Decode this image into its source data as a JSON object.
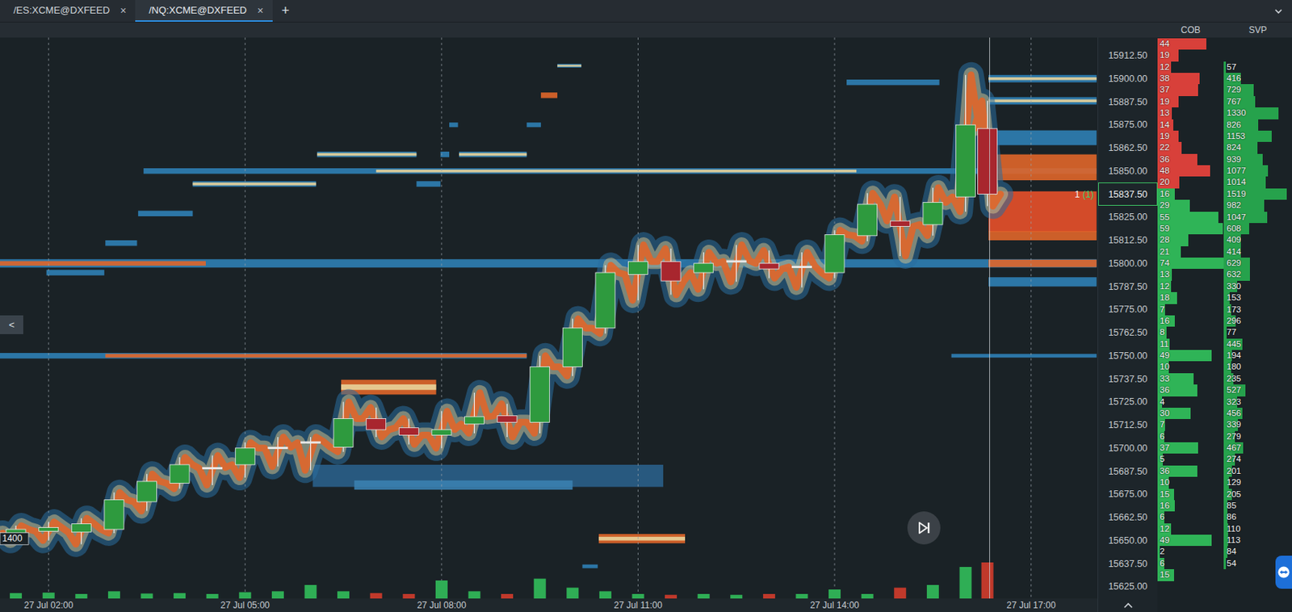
{
  "tabs": [
    {
      "label": "/ES:XCME@DXFEED",
      "close": "×",
      "selected": false
    },
    {
      "label": "/NQ:XCME@DXFEED",
      "close": "×",
      "selected": true
    }
  ],
  "new_tab": "+",
  "columns": {
    "cob": "COB",
    "svp": "SVP"
  },
  "collapse_button": "<",
  "left_label": {
    "text": "1400",
    "price": 15651
  },
  "marker": {
    "count": "1",
    "detail": "(1)",
    "price": 15837.5
  },
  "now": 982,
  "price_axis": {
    "labels": [
      {
        "text": "15912.50",
        "selected": false
      },
      {
        "text": "15900.00",
        "selected": false
      },
      {
        "text": "15887.50",
        "selected": false
      },
      {
        "text": "15875.00",
        "selected": false
      },
      {
        "text": "15862.50",
        "selected": false
      },
      {
        "text": "15850.00",
        "selected": false
      },
      {
        "text": "15837.50",
        "selected": true
      },
      {
        "text": "15825.00",
        "selected": false
      },
      {
        "text": "15812.50",
        "selected": false
      },
      {
        "text": "15800.00",
        "selected": false
      },
      {
        "text": "15787.50",
        "selected": false
      },
      {
        "text": "15775.00",
        "selected": false
      },
      {
        "text": "15762.50",
        "selected": false
      },
      {
        "text": "15750.00",
        "selected": false
      },
      {
        "text": "15737.50",
        "selected": false
      },
      {
        "text": "15725.00",
        "selected": false
      },
      {
        "text": "15712.50",
        "selected": false
      },
      {
        "text": "15700.00",
        "selected": false
      },
      {
        "text": "15687.50",
        "selected": false
      },
      {
        "text": "15675.00",
        "selected": false
      },
      {
        "text": "15662.50",
        "selected": false
      },
      {
        "text": "15650.00",
        "selected": false
      },
      {
        "text": "15637.50",
        "selected": false
      },
      {
        "text": "15625.00",
        "selected": false
      }
    ]
  },
  "time_axis": {
    "labels": [
      {
        "text": "27 Jul 02:00",
        "t": 120
      },
      {
        "text": "27 Jul 05:00",
        "t": 300
      },
      {
        "text": "27 Jul 08:00",
        "t": 480
      },
      {
        "text": "27 Jul 11:00",
        "t": 660
      },
      {
        "text": "27 Jul 14:00",
        "t": 840
      },
      {
        "text": "27 Jul 17:00",
        "t": 1020
      }
    ]
  },
  "cob": [
    {
      "value": "44",
      "side": "ask"
    },
    {
      "value": "19",
      "side": "ask"
    },
    {
      "value": "12",
      "side": "ask"
    },
    {
      "value": "38",
      "side": "ask"
    },
    {
      "value": "37",
      "side": "ask"
    },
    {
      "value": "19",
      "side": "ask"
    },
    {
      "value": "13",
      "side": "ask"
    },
    {
      "value": "14",
      "side": "ask"
    },
    {
      "value": "19",
      "side": "ask"
    },
    {
      "value": "22",
      "side": "ask"
    },
    {
      "value": "36",
      "side": "ask"
    },
    {
      "value": "48",
      "side": "ask"
    },
    {
      "value": "20",
      "side": "ask"
    },
    {
      "value": "16",
      "side": "bid"
    },
    {
      "value": "29",
      "side": "bid"
    },
    {
      "value": "55",
      "side": "bid"
    },
    {
      "value": "59",
      "side": "bid"
    },
    {
      "value": "28",
      "side": "bid"
    },
    {
      "value": "21",
      "side": "bid"
    },
    {
      "value": "74",
      "side": "bid"
    },
    {
      "value": "13",
      "side": "bid"
    },
    {
      "value": "12",
      "side": "bid"
    },
    {
      "value": "18",
      "side": "bid"
    },
    {
      "value": "7",
      "side": "bid"
    },
    {
      "value": "16",
      "side": "bid"
    },
    {
      "value": "8",
      "side": "bid"
    },
    {
      "value": "11",
      "side": "bid"
    },
    {
      "value": "49",
      "side": "bid"
    },
    {
      "value": "10",
      "side": "bid"
    },
    {
      "value": "33",
      "side": "bid"
    },
    {
      "value": "36",
      "side": "bid"
    },
    {
      "value": "4",
      "side": "bid"
    },
    {
      "value": "30",
      "side": "bid"
    },
    {
      "value": "7",
      "side": "bid"
    },
    {
      "value": "6",
      "side": "bid"
    },
    {
      "value": "37",
      "side": "bid"
    },
    {
      "value": "5",
      "side": "bid"
    },
    {
      "value": "36",
      "side": "bid"
    },
    {
      "value": "10",
      "side": "bid"
    },
    {
      "value": "15",
      "side": "bid"
    },
    {
      "value": "16",
      "side": "bid"
    },
    {
      "value": "6",
      "side": "bid"
    },
    {
      "value": "12",
      "side": "bid"
    },
    {
      "value": "49",
      "side": "bid"
    },
    {
      "value": "2",
      "side": "bid"
    },
    {
      "value": "6",
      "side": "bid"
    },
    {
      "value": "15",
      "side": "bid"
    }
  ],
  "svp": [
    "57",
    "416",
    "729",
    "767",
    "1330",
    "826",
    "1153",
    "824",
    "939",
    "1077",
    "1014",
    "1519",
    "982",
    "1047",
    "608",
    "409",
    "414",
    "629",
    "632",
    "330",
    "153",
    "173",
    "296",
    "77",
    "445",
    "194",
    "180",
    "235",
    "527",
    "323",
    "456",
    "339",
    "279",
    "467",
    "274",
    "201",
    "129",
    "205",
    "85",
    "86",
    "110",
    "113",
    "84",
    "54"
  ],
  "candles": [
    {
      "t": 90,
      "open": 15654,
      "high": 15658,
      "low": 15650,
      "close": 15656,
      "volume": 600
    },
    {
      "t": 120,
      "open": 15655,
      "high": 15660,
      "low": 15650,
      "close": 15657,
      "volume": 650
    },
    {
      "t": 150,
      "open": 15654.5,
      "high": 15662,
      "low": 15648,
      "close": 15659,
      "volume": 500
    },
    {
      "t": 180,
      "open": 15656,
      "high": 15676,
      "low": 15654,
      "close": 15672,
      "volume": 800
    },
    {
      "t": 210,
      "open": 15671,
      "high": 15686,
      "low": 15666,
      "close": 15682,
      "volume": 550
    },
    {
      "t": 240,
      "open": 15681,
      "high": 15695,
      "low": 15678,
      "close": 15691,
      "volume": 600
    },
    {
      "t": 270,
      "open": 15689,
      "high": 15696,
      "low": 15680,
      "close": 15689.5,
      "volume": 500
    },
    {
      "t": 300,
      "open": 15691,
      "high": 15703,
      "low": 15684,
      "close": 15700,
      "volume": 700
    },
    {
      "t": 330,
      "open": 15700,
      "high": 15706,
      "low": 15690,
      "close": 15700.5,
      "volume": 800
    },
    {
      "t": 360,
      "open": 15703,
      "high": 15706,
      "low": 15688,
      "close": 15703.5,
      "volume": 1500
    },
    {
      "t": 390,
      "open": 15700.5,
      "high": 15725,
      "low": 15698,
      "close": 15716,
      "volume": 800
    },
    {
      "t": 420,
      "open": 15716,
      "high": 15722,
      "low": 15706,
      "close": 15710,
      "volume": 600
    },
    {
      "t": 450,
      "open": 15711,
      "high": 15716,
      "low": 15702,
      "close": 15707,
      "volume": 500
    },
    {
      "t": 480,
      "open": 15707,
      "high": 15720,
      "low": 15700,
      "close": 15710,
      "volume": 2000
    },
    {
      "t": 510,
      "open": 15713,
      "high": 15730,
      "low": 15708,
      "close": 15717,
      "volume": 800
    },
    {
      "t": 540,
      "open": 15717.5,
      "high": 15724,
      "low": 15706,
      "close": 15714,
      "volume": 500
    },
    {
      "t": 570,
      "open": 15714,
      "high": 15750,
      "low": 15708,
      "close": 15744,
      "volume": 2200
    },
    {
      "t": 600,
      "open": 15744,
      "high": 15770,
      "low": 15739,
      "close": 15765,
      "volume": 1200
    },
    {
      "t": 630,
      "open": 15765,
      "high": 15799,
      "low": 15762,
      "close": 15795,
      "volume": 800
    },
    {
      "t": 660,
      "open": 15794,
      "high": 15810,
      "low": 15780,
      "close": 15801,
      "volume": 500
    },
    {
      "t": 690,
      "open": 15801,
      "high": 15808,
      "low": 15783,
      "close": 15790.5,
      "volume": 400
    },
    {
      "t": 720,
      "open": 15795,
      "high": 15806,
      "low": 15786,
      "close": 15800,
      "volume": 500
    },
    {
      "t": 750,
      "open": 15801,
      "high": 15810,
      "low": 15790,
      "close": 15801.5,
      "volume": 400
    },
    {
      "t": 780,
      "open": 15800,
      "high": 15807,
      "low": 15792,
      "close": 15797,
      "volume": 500
    },
    {
      "t": 810,
      "open": 15798,
      "high": 15806,
      "low": 15787,
      "close": 15798.5,
      "volume": 500
    },
    {
      "t": 840,
      "open": 15795,
      "high": 15818,
      "low": 15792,
      "close": 15815.5,
      "volume": 1000
    },
    {
      "t": 870,
      "open": 15815,
      "high": 15838,
      "low": 15812,
      "close": 15832,
      "volume": 500
    },
    {
      "t": 900,
      "open": 15823,
      "high": 15836,
      "low": 15804,
      "close": 15820,
      "volume": 1200
    },
    {
      "t": 930,
      "open": 15821,
      "high": 15841,
      "low": 15815,
      "close": 15833,
      "volume": 1500
    },
    {
      "t": 960,
      "open": 15836,
      "high": 15902,
      "low": 15828,
      "close": 15875,
      "volume": 3500
    },
    {
      "t": 980,
      "open": 15873,
      "high": 15888,
      "low": 15831,
      "close": 15837.5,
      "volume": 4000
    }
  ],
  "heatmap": {
    "bands": [
      {
        "price": 15800,
        "size": 4.5,
        "from": 75,
        "to": 1080,
        "color": "#2f7fb5"
      },
      {
        "price": 15800,
        "size": 2.5,
        "from": 75,
        "to": 264,
        "color": "#e0662a"
      },
      {
        "price": 15750,
        "size": 3,
        "from": 75,
        "to": 558,
        "color": "#2f7fb5"
      },
      {
        "price": 15750,
        "size": 2,
        "from": 172,
        "to": 558,
        "color": "#e0662a"
      },
      {
        "price": 15750,
        "size": 2,
        "from": 947,
        "to": 1080,
        "color": "#2f7fb5"
      },
      {
        "price": 15850,
        "size": 3,
        "from": 207,
        "to": 1080,
        "color": "#2f7fb5"
      },
      {
        "price": 15850,
        "size": 1.5,
        "from": 420,
        "to": 860,
        "color": "#e8d39a"
      },
      {
        "price": 15907,
        "size": 2,
        "from": 586,
        "to": 608,
        "color": "#2f7fb5"
      },
      {
        "price": 15907,
        "size": 1,
        "from": 586,
        "to": 608,
        "color": "#e8d39a"
      },
      {
        "price": 15891,
        "size": 3,
        "from": 571,
        "to": 586,
        "color": "#e0662a"
      },
      {
        "price": 15875,
        "size": 2.5,
        "from": 487,
        "to": 495,
        "color": "#2f7fb5"
      },
      {
        "price": 15875,
        "size": 2.5,
        "from": 558,
        "to": 571,
        "color": "#2f7fb5"
      },
      {
        "price": 15859,
        "size": 3,
        "from": 366,
        "to": 457,
        "color": "#2f7fb5"
      },
      {
        "price": 15859,
        "size": 1.5,
        "from": 366,
        "to": 457,
        "color": "#e8d39a"
      },
      {
        "price": 15859,
        "size": 3,
        "from": 479,
        "to": 487,
        "color": "#2f7fb5"
      },
      {
        "price": 15859,
        "size": 3,
        "from": 496,
        "to": 558,
        "color": "#2f7fb5"
      },
      {
        "price": 15859,
        "size": 1.5,
        "from": 496,
        "to": 558,
        "color": "#e8d39a"
      },
      {
        "price": 15843,
        "size": 3,
        "from": 252,
        "to": 365,
        "color": "#2f7fb5"
      },
      {
        "price": 15843,
        "size": 1.5,
        "from": 252,
        "to": 365,
        "color": "#e8d39a"
      },
      {
        "price": 15843,
        "size": 3,
        "from": 457,
        "to": 479,
        "color": "#2f7fb5"
      },
      {
        "price": 15827,
        "size": 3,
        "from": 202,
        "to": 252,
        "color": "#2f7fb5"
      },
      {
        "price": 15811,
        "size": 3,
        "from": 172,
        "to": 201,
        "color": "#2f7fb5"
      },
      {
        "price": 15795,
        "size": 3,
        "from": 118,
        "to": 171,
        "color": "#2f7fb5"
      },
      {
        "price": 15651,
        "size": 5,
        "from": 624,
        "to": 703,
        "color": "#e0662a"
      },
      {
        "price": 15651,
        "size": 2,
        "from": 624,
        "to": 703,
        "color": "#e8d39a"
      },
      {
        "price": 15636,
        "size": 2,
        "from": 609,
        "to": 623,
        "color": "#2f7fb5"
      },
      {
        "price": 15898,
        "size": 3,
        "from": 851,
        "to": 936,
        "color": "#2f7fb5"
      },
      {
        "price": 15685,
        "size": 12,
        "from": 362,
        "to": 683,
        "color": "#2a5f8a"
      },
      {
        "price": 15680,
        "size": 5,
        "from": 400,
        "to": 600,
        "color": "#3a7fb0"
      },
      {
        "price": 15733,
        "size": 8,
        "from": 388,
        "to": 475,
        "color": "#e0662a"
      },
      {
        "price": 15733,
        "size": 3,
        "from": 388,
        "to": 475,
        "color": "#e8d39a"
      },
      {
        "price": 15900,
        "size": 4,
        "from": 981,
        "to": 1080,
        "color": "#2f7fb5"
      },
      {
        "price": 15900,
        "size": 1.5,
        "from": 981,
        "to": 1080,
        "color": "#e8d39a"
      },
      {
        "price": 15888,
        "size": 4,
        "from": 981,
        "to": 1080,
        "color": "#2f7fb5"
      },
      {
        "price": 15888,
        "size": 1.5,
        "from": 981,
        "to": 1080,
        "color": "#e8d39a"
      },
      {
        "price": 15868,
        "size": 8,
        "from": 981,
        "to": 1080,
        "color": "#2f7fb5"
      },
      {
        "price": 15852,
        "size": 14,
        "from": 981,
        "to": 1080,
        "color": "#e0662a"
      },
      {
        "price": 15828,
        "size": 22,
        "from": 981,
        "to": 1080,
        "color": "#e8502a"
      },
      {
        "price": 15815,
        "size": 5,
        "from": 981,
        "to": 1080,
        "color": "#e0662a"
      },
      {
        "price": 15800,
        "size": 4,
        "from": 981,
        "to": 1080,
        "color": "#e0662a"
      },
      {
        "price": 15790,
        "size": 5,
        "from": 981,
        "to": 1080,
        "color": "#2f7fb5"
      }
    ]
  }
}
